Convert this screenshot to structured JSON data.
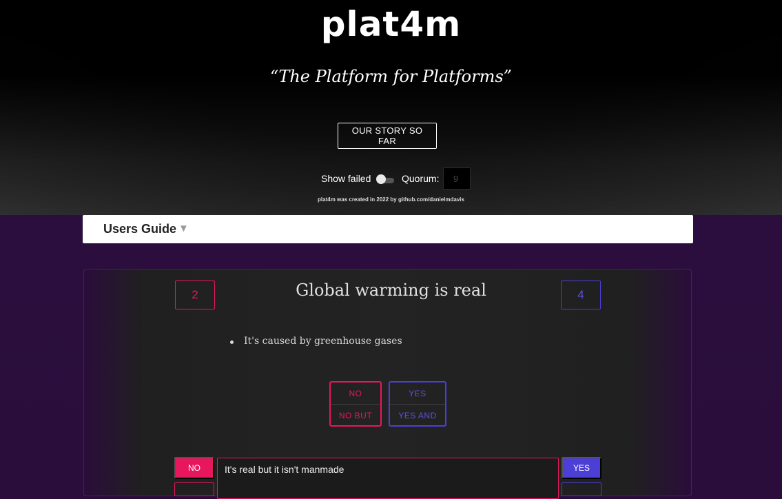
{
  "header": {
    "logo": "plat4m",
    "tagline": "“The Platform for Platforms”",
    "story_button": "OUR STORY SO FAR",
    "show_failed_label": "Show failed",
    "show_failed_on": false,
    "quorum_label": "Quorum:",
    "quorum_value": "9",
    "credit": "plat4m was created in 2022 by github.com/danielmdavis"
  },
  "guide": {
    "title": "Users Guide",
    "caret": "▼"
  },
  "proposal": {
    "no_count": "2",
    "yes_count": "4",
    "title": "Global warming is real",
    "reasons": [
      "It's caused by greenhouse gases"
    ],
    "votes": {
      "no": "NO",
      "no_but": "NO BUT",
      "yes": "YES",
      "yes_and": "YES AND"
    },
    "reply": {
      "no_label": "NO",
      "yes_label": "YES",
      "text": "It's real but it isn't manmade"
    }
  },
  "colors": {
    "no": "#e8175d",
    "yes": "#4b3fd6",
    "background": "#2a0d3a"
  }
}
